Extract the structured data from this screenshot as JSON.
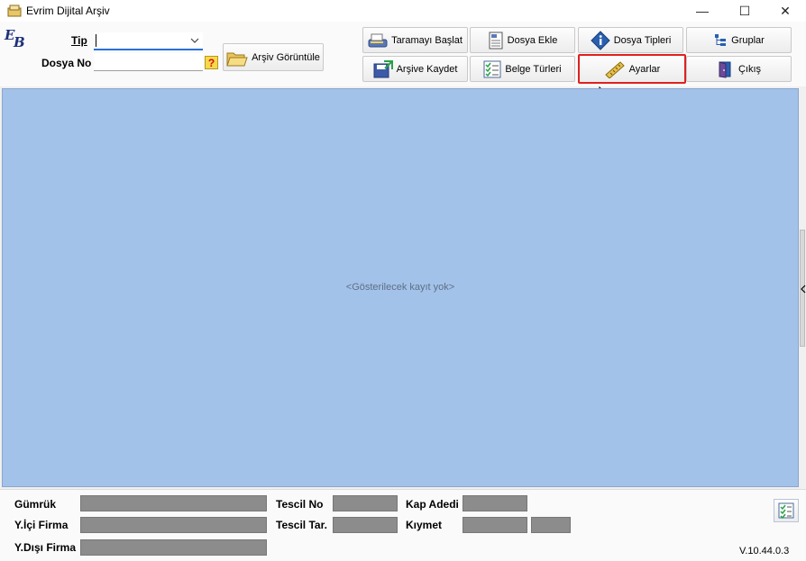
{
  "window": {
    "title": "Evrim Dijital Arşiv",
    "minimize": "—",
    "maximize": "☐",
    "close": "✕"
  },
  "form": {
    "tip_label": "Tip",
    "dosya_no_label": "Dosya No",
    "tip_value": "",
    "dosya_no_value": "",
    "help_glyph": "?",
    "archive_view_button": "Arşiv Görüntüle"
  },
  "toolbar": {
    "buttons": [
      {
        "label": "Taramayı Başlat",
        "icon": "scanner-icon"
      },
      {
        "label": "Dosya Ekle",
        "icon": "document-icon"
      },
      {
        "label": "Dosya Tipleri",
        "icon": "info-icon"
      },
      {
        "label": "Gruplar",
        "icon": "groups-icon"
      },
      {
        "label": "Arşive Kaydet",
        "icon": "save-icon"
      },
      {
        "label": "Belge Türleri",
        "icon": "checklist-icon"
      },
      {
        "label": "Ayarlar",
        "icon": "ruler-icon"
      },
      {
        "label": "Çıkış",
        "icon": "exit-door-icon"
      }
    ],
    "highlight_color": "#e02020"
  },
  "grid": {
    "empty_text": "<Gösterilecek kayıt yok>",
    "background": "#a3c2e9"
  },
  "details": {
    "gumruk": "Gümrük",
    "yici_firma": "Y.İçi Firma",
    "ydisi_firma": "Y.Dışı Firma",
    "tescil_no": "Tescil No",
    "tescil_tar": "Tescil Tar.",
    "kap_adedi": "Kap Adedi",
    "kiymet": "Kıymet"
  },
  "version": "V.10.44.0.3"
}
